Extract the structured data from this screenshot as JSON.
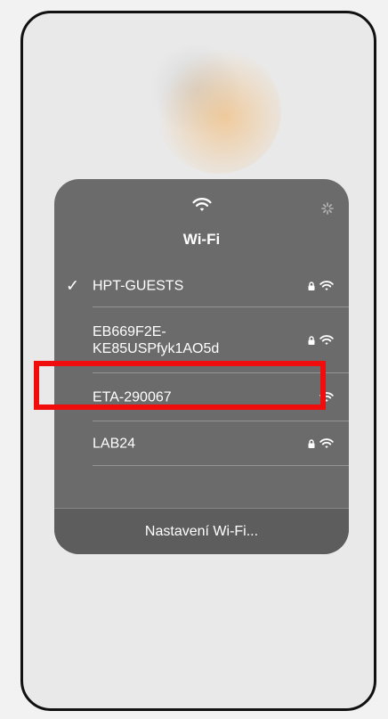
{
  "panel": {
    "title": "Wi-Fi",
    "icons": {
      "header": "wifi-icon",
      "status": "loading-spinner-icon"
    }
  },
  "networks": [
    {
      "name": "HPT-GUESTS",
      "connected": true,
      "secured": true
    },
    {
      "name": "EB669F2E-\nKE85USPfyk1AO5d",
      "connected": false,
      "secured": true
    },
    {
      "name": "ETA-290067",
      "connected": false,
      "secured": false,
      "highlighted": true
    },
    {
      "name": "LAB24",
      "connected": false,
      "secured": true
    }
  ],
  "footer": {
    "settings_label": "Nastavení Wi-Fi..."
  },
  "colors": {
    "highlight": "#f20d0d",
    "panel": "#6b6b6b"
  }
}
